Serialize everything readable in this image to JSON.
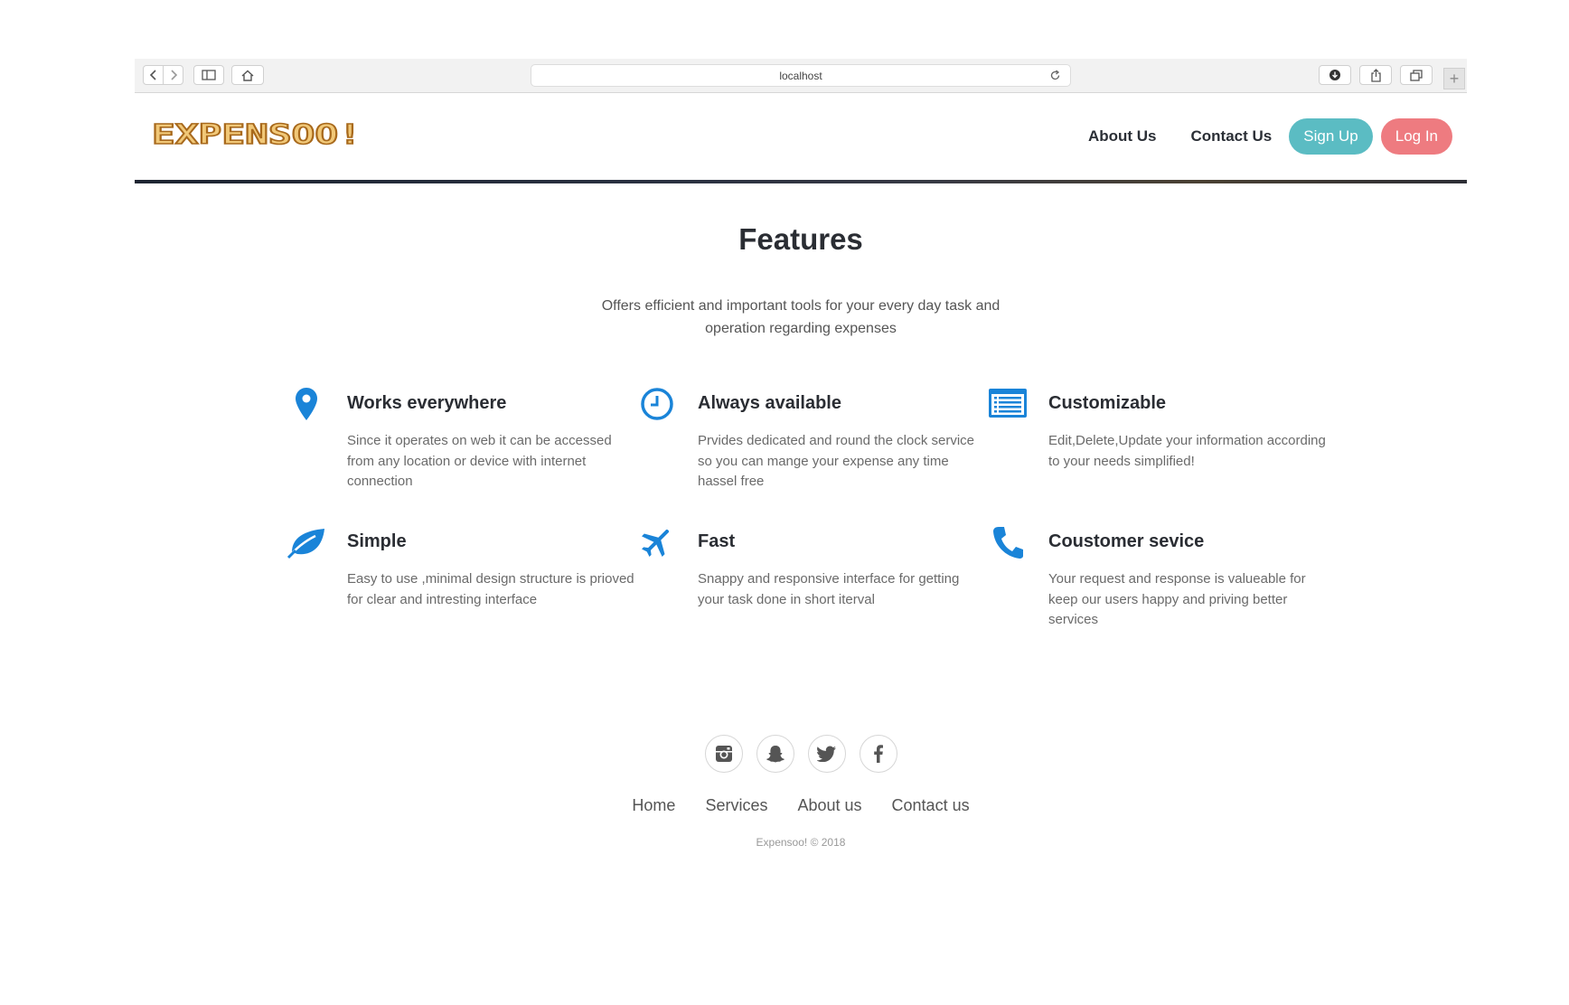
{
  "browser": {
    "address": "localhost",
    "new_tab_symbol": "+",
    "buttons": [
      "back-icon",
      "forward-icon",
      "sidebar-icon",
      "home-icon",
      "reload-icon",
      "download-icon",
      "share-icon",
      "tabs-icon"
    ]
  },
  "header": {
    "logo_text": "EXPENSOO!",
    "nav": [
      "About Us",
      "Contact Us"
    ],
    "signup_label": "Sign Up",
    "login_label": "Log In"
  },
  "colors": {
    "accent_blue": "#1a84d8",
    "signup_bg": "#5bbcc3",
    "login_bg": "#ee7b80",
    "logo_gold": "#d39a3c"
  },
  "features": {
    "title": "Features",
    "subtitle": "Offers efficient and important tools for your every day task and operation regarding expenses",
    "items": [
      {
        "icon": "map-pin-icon",
        "title": "Works everywhere",
        "text": "Since it operates on web it can be accessed from any location or device with internet connection"
      },
      {
        "icon": "clock-icon",
        "title": "Always available",
        "text": "Prvides dedicated and round the clock service so you can mange your expense any time hassel free"
      },
      {
        "icon": "list-icon",
        "title": "Customizable",
        "text": "Edit,Delete,Update your information according to your needs simplified!"
      },
      {
        "icon": "leaf-icon",
        "title": "Simple",
        "text": "Easy to use ,minimal design structure is prioved for clear and intresting interface"
      },
      {
        "icon": "airplane-icon",
        "title": "Fast",
        "text": "Snappy and responsive interface for getting your task done in short iterval"
      },
      {
        "icon": "phone-icon",
        "title": "Coustomer sevice",
        "text": "Your request and response is valueable for keep our users happy and priving better services"
      }
    ]
  },
  "footer": {
    "socials": [
      "instagram-icon",
      "snapchat-icon",
      "twitter-icon",
      "facebook-icon"
    ],
    "links": [
      "Home",
      "Services",
      "About us",
      "Contact us"
    ],
    "copyright": "Expensoo! © 2018"
  }
}
